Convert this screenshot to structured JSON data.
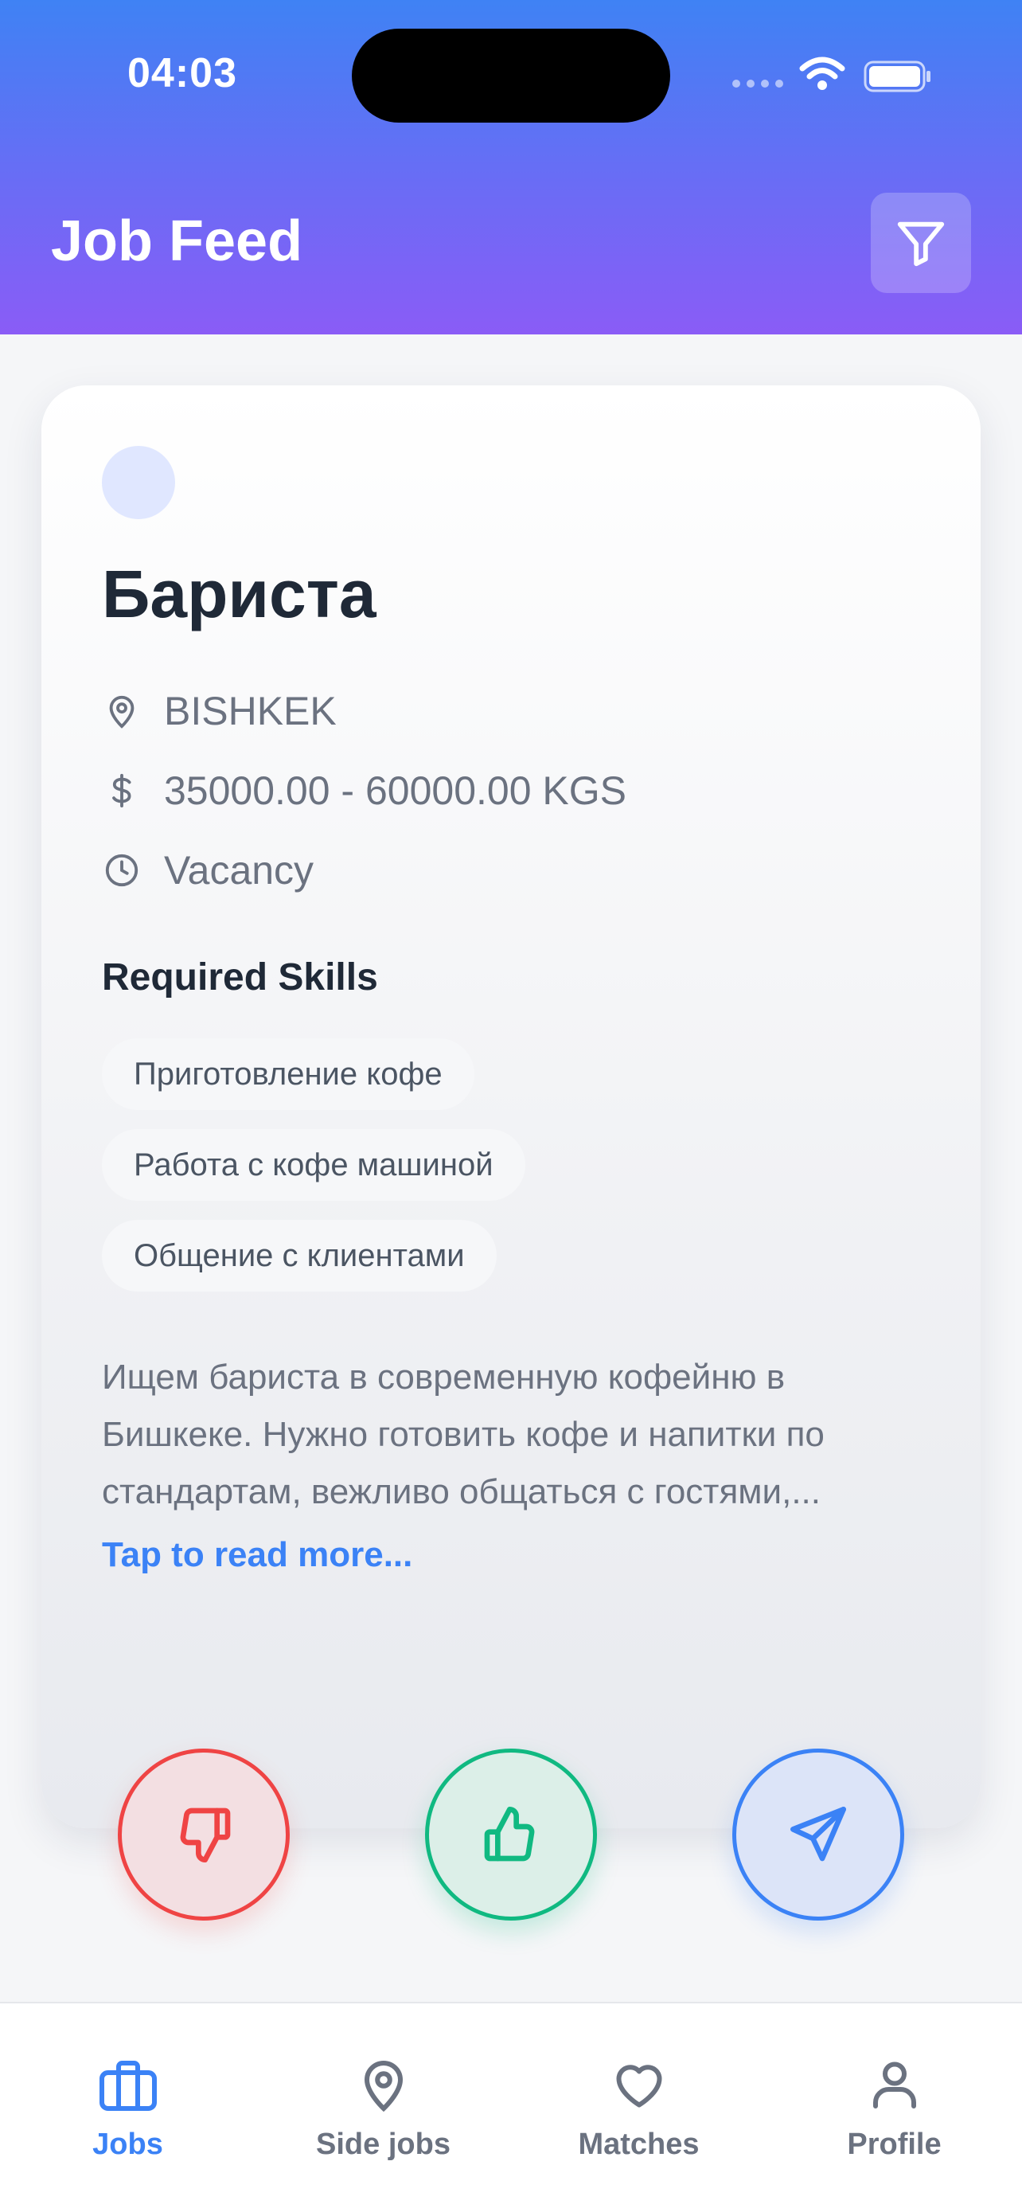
{
  "status_bar": {
    "time": "04:03"
  },
  "header": {
    "title": "Job Feed"
  },
  "job": {
    "title": "Бариста",
    "location": "BISHKEK",
    "salary": "35000.00 - 60000.00 KGS",
    "type": "Vacancy",
    "skills_heading": "Required Skills",
    "skills": [
      "Приготовление кофе",
      "Работа с кофе машиной",
      "Общение с клиентами"
    ],
    "description_lines": [
      "Ищем бариста в современную кофейню в",
      "Бишкеке. Нужно готовить кофе и напитки по",
      "стандартам, вежливо общаться с гостями,..."
    ],
    "read_more": "Tap to read more..."
  },
  "colors": {
    "accent": "#3b82f6",
    "dislike": "#ef4444",
    "like": "#10b981",
    "header_top": "#3f82f4",
    "header_bottom": "#8a5cf6"
  },
  "tabs": [
    {
      "label": "Jobs",
      "icon": "briefcase-icon",
      "active": true
    },
    {
      "label": "Side jobs",
      "icon": "map-pin-icon",
      "active": false
    },
    {
      "label": "Matches",
      "icon": "heart-icon",
      "active": false
    },
    {
      "label": "Profile",
      "icon": "user-icon",
      "active": false
    }
  ]
}
